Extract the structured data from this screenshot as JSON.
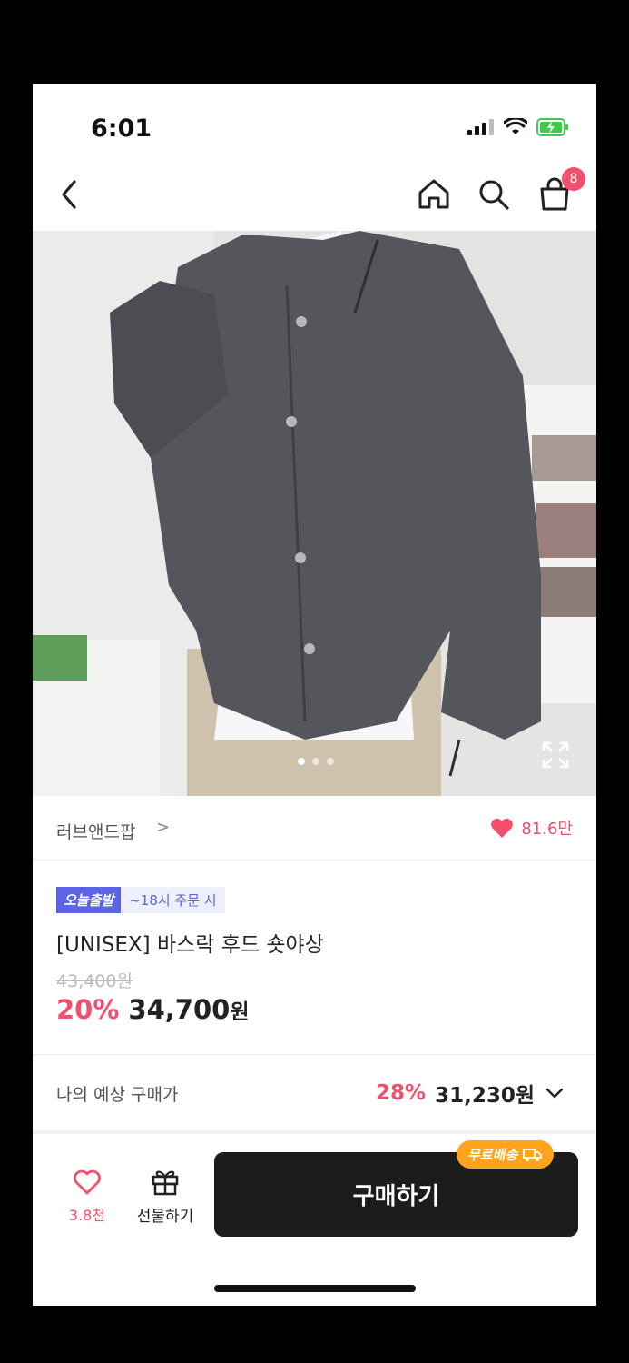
{
  "status_bar": {
    "time": "6:01"
  },
  "nav": {
    "cart_count": "8"
  },
  "colors": {
    "accent": "#f0506e",
    "badge_blue": "#5b64e6",
    "buy_button": "#1c1c1c",
    "free_shipping": "#ffa41c"
  },
  "brand": {
    "name": "러브앤드팝",
    "chevron": ">",
    "likes": "81.6만"
  },
  "badges": {
    "today_ship": "오늘출발",
    "deadline": "~18시 주문 시"
  },
  "product": {
    "title": "[UNISEX] 바스락 후드 숏야상",
    "original_price": "43,400원",
    "discount": "20%",
    "price": "34,700",
    "price_unit": "원"
  },
  "expected": {
    "label": "나의 예상 구매가",
    "discount": "28%",
    "price": "31,230원"
  },
  "bottom_bar": {
    "wish_count": "3.8천",
    "gift_label": "선물하기",
    "buy_label": "구매하기",
    "free_shipping": "무료배송"
  }
}
